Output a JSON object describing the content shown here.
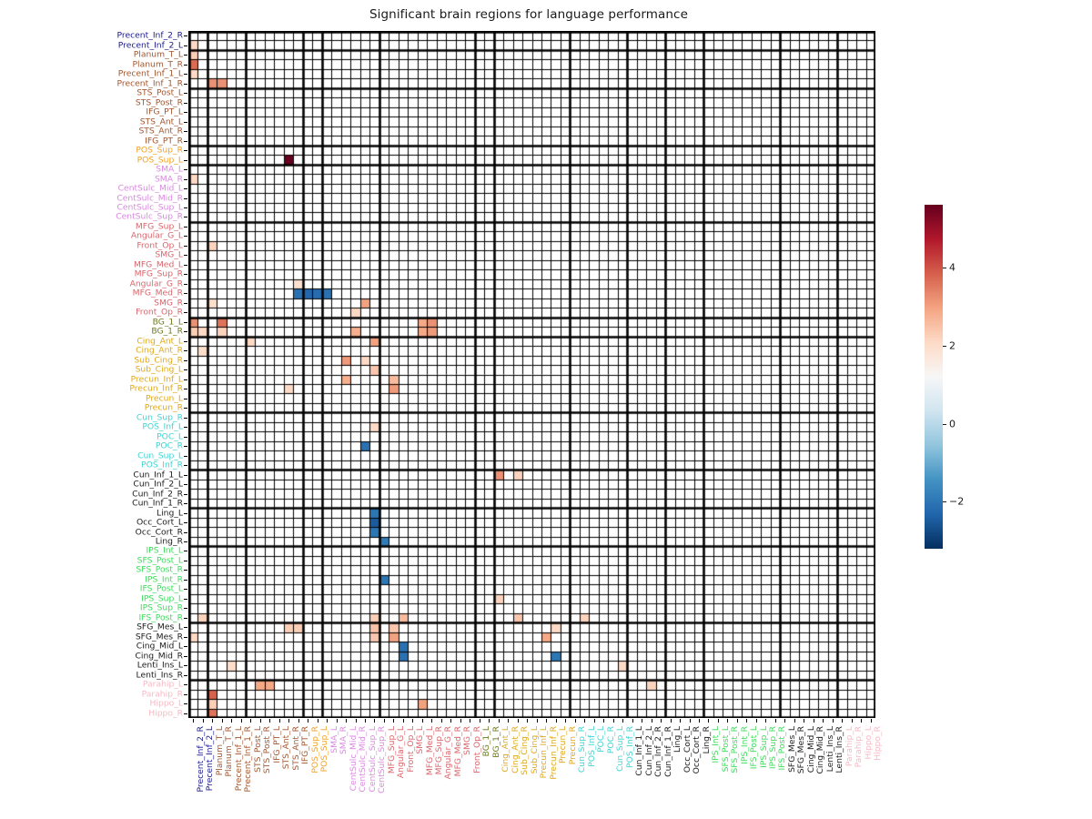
{
  "title": "Significant brain regions for language performance",
  "chart_data": {
    "type": "heatmap",
    "title": "Significant brain regions for language performance",
    "xlabel": "",
    "ylabel": "",
    "colormap": "RdBu_r",
    "vmin": -3.2,
    "vmax": 5.6,
    "colorbar": {
      "ticks": [
        -2,
        0,
        2,
        4
      ],
      "tick_labels": [
        "−2",
        "0",
        "2",
        "4"
      ],
      "position": "right"
    },
    "grid": true,
    "cell_edge_color": "#000000",
    "block_separator_color": "#000000",
    "n_rows": 57,
    "n_cols": 57,
    "symmetric_labels": true,
    "label_colors": {
      "navy": "#1a1a8c",
      "brown": "#a3562e",
      "orange": "#f2a125",
      "violet": "#d98ae0",
      "rose": "#d9656b",
      "olive": "#6e7a1e",
      "gold": "#dfa81a",
      "cyan": "#3fd4d4",
      "black": "#1a1a1a",
      "green": "#3ddc5c",
      "pink": "#f8b8c4"
    },
    "labels": [
      {
        "name": "Precent_Inf_2_R",
        "color": "navy"
      },
      {
        "name": "Precent_Inf_2_L",
        "color": "navy"
      },
      {
        "name": "Planum_T_L",
        "color": "brown"
      },
      {
        "name": "Planum_T_R",
        "color": "brown"
      },
      {
        "name": "Precent_Inf_1_L",
        "color": "brown"
      },
      {
        "name": "Precent_Inf_1_R",
        "color": "brown"
      },
      {
        "name": "STS_Post_L",
        "color": "brown"
      },
      {
        "name": "STS_Post_R",
        "color": "brown"
      },
      {
        "name": "IFG_PT_L",
        "color": "brown"
      },
      {
        "name": "STS_Ant_L",
        "color": "brown"
      },
      {
        "name": "STS_Ant_R",
        "color": "brown"
      },
      {
        "name": "IFG_PT_R",
        "color": "brown"
      },
      {
        "name": "POS_Sup_R",
        "color": "orange"
      },
      {
        "name": "POS_Sup_L",
        "color": "orange"
      },
      {
        "name": "SMA_L",
        "color": "violet"
      },
      {
        "name": "SMA_R",
        "color": "violet"
      },
      {
        "name": "CentSulc_Mid_L",
        "color": "violet"
      },
      {
        "name": "CentSulc_Mid_R",
        "color": "violet"
      },
      {
        "name": "CentSulc_Sup_L",
        "color": "violet"
      },
      {
        "name": "CentSulc_Sup_R",
        "color": "violet"
      },
      {
        "name": "MFG_Sup_L",
        "color": "rose"
      },
      {
        "name": "Angular_G_L",
        "color": "rose"
      },
      {
        "name": "Front_Op_L",
        "color": "rose"
      },
      {
        "name": "SMG_L",
        "color": "rose"
      },
      {
        "name": "MFG_Med_L",
        "color": "rose"
      },
      {
        "name": "MFG_Sup_R",
        "color": "rose"
      },
      {
        "name": "Angular_G_R",
        "color": "rose"
      },
      {
        "name": "MFG_Med_R",
        "color": "rose"
      },
      {
        "name": "SMG_R",
        "color": "rose"
      },
      {
        "name": "Front_Op_R",
        "color": "rose"
      },
      {
        "name": "BG_1_L",
        "color": "olive"
      },
      {
        "name": "BG_1_R",
        "color": "olive"
      },
      {
        "name": "Cing_Ant_L",
        "color": "gold"
      },
      {
        "name": "Cing_Ant_R",
        "color": "gold"
      },
      {
        "name": "Sub_Cing_R",
        "color": "gold"
      },
      {
        "name": "Sub_Cing_L",
        "color": "gold"
      },
      {
        "name": "Precun_Inf_L",
        "color": "gold"
      },
      {
        "name": "Precun_Inf_R",
        "color": "gold"
      },
      {
        "name": "Precun_L",
        "color": "gold"
      },
      {
        "name": "Precun_R",
        "color": "gold"
      },
      {
        "name": "Cun_Sup_R",
        "color": "cyan"
      },
      {
        "name": "POS_Inf_L",
        "color": "cyan"
      },
      {
        "name": "POC_L",
        "color": "cyan"
      },
      {
        "name": "POC_R",
        "color": "cyan"
      },
      {
        "name": "Cun_Sup_L",
        "color": "cyan"
      },
      {
        "name": "POS_Inf_R",
        "color": "cyan"
      },
      {
        "name": "Cun_Inf_1_L",
        "color": "black"
      },
      {
        "name": "Cun_Inf_2_L",
        "color": "black"
      },
      {
        "name": "Cun_Inf_2_R",
        "color": "black"
      },
      {
        "name": "Cun_Inf_1_R",
        "color": "black"
      },
      {
        "name": "Ling_L",
        "color": "black"
      },
      {
        "name": "Occ_Cort_L",
        "color": "black"
      },
      {
        "name": "Occ_Cort_R",
        "color": "black"
      },
      {
        "name": "Ling_R",
        "color": "black"
      },
      {
        "name": "IPS_Int_L",
        "color": "green"
      },
      {
        "name": "SFS_Post_L",
        "color": "green"
      },
      {
        "name": "SFS_Post_R",
        "color": "green"
      },
      {
        "name": "IPS_Int_R",
        "color": "green"
      },
      {
        "name": "IFS_Post_L",
        "color": "green"
      },
      {
        "name": "IPS_Sup_L",
        "color": "green"
      },
      {
        "name": "IPS_Sup_R",
        "color": "green"
      },
      {
        "name": "IFS_Post_R",
        "color": "green"
      },
      {
        "name": "SFG_Mes_L",
        "color": "black"
      },
      {
        "name": "SFG_Mes_R",
        "color": "black"
      },
      {
        "name": "Cing_Mid_L",
        "color": "black"
      },
      {
        "name": "Cing_Mid_R",
        "color": "black"
      },
      {
        "name": "Lenti_Ins_L",
        "color": "black"
      },
      {
        "name": "Lenti_Ins_R",
        "color": "black"
      },
      {
        "name": "Parahip_L",
        "color": "pink"
      },
      {
        "name": "Parahip_R",
        "color": "pink"
      },
      {
        "name": "Hippo_L",
        "color": "pink"
      },
      {
        "name": "Hippo_R",
        "color": "pink"
      }
    ],
    "block_boundaries": [
      2,
      6,
      12,
      14,
      20,
      30,
      32,
      40,
      46,
      50,
      54,
      62,
      68
    ],
    "cells": [
      {
        "row": 1,
        "col": 0,
        "value": 2.1
      },
      {
        "row": 2,
        "col": 0,
        "value": 2.3
      },
      {
        "row": 3,
        "col": 0,
        "value": 3.7
      },
      {
        "row": 4,
        "col": 0,
        "value": 2.1
      },
      {
        "row": 5,
        "col": 2,
        "value": 3.2
      },
      {
        "row": 5,
        "col": 3,
        "value": 3.2
      },
      {
        "row": 13,
        "col": 10,
        "value": 5.6
      },
      {
        "row": 15,
        "col": 0,
        "value": 2.1
      },
      {
        "row": 22,
        "col": 2,
        "value": 2.2
      },
      {
        "row": 26,
        "col": 11,
        "value": 1.9
      },
      {
        "row": 27,
        "col": 11,
        "value": -2.1
      },
      {
        "row": 27,
        "col": 12,
        "value": -2.3
      },
      {
        "row": 27,
        "col": 13,
        "value": -2.2
      },
      {
        "row": 27,
        "col": 14,
        "value": -2.1
      },
      {
        "row": 28,
        "col": 2,
        "value": 2.0
      },
      {
        "row": 28,
        "col": 18,
        "value": 3.0
      },
      {
        "row": 29,
        "col": 17,
        "value": 2.1
      },
      {
        "row": 30,
        "col": 0,
        "value": 3.2
      },
      {
        "row": 30,
        "col": 3,
        "value": 3.6
      },
      {
        "row": 30,
        "col": 24,
        "value": 2.9
      },
      {
        "row": 30,
        "col": 25,
        "value": 3.2
      },
      {
        "row": 31,
        "col": 0,
        "value": 2.3
      },
      {
        "row": 31,
        "col": 1,
        "value": 2.1
      },
      {
        "row": 31,
        "col": 3,
        "value": 2.2
      },
      {
        "row": 31,
        "col": 17,
        "value": 2.8
      },
      {
        "row": 31,
        "col": 24,
        "value": 2.9
      },
      {
        "row": 31,
        "col": 25,
        "value": 3.1
      },
      {
        "row": 32,
        "col": 6,
        "value": 2.1
      },
      {
        "row": 32,
        "col": 19,
        "value": 3.0
      },
      {
        "row": 33,
        "col": 1,
        "value": 2.0
      },
      {
        "row": 34,
        "col": 16,
        "value": 3.1
      },
      {
        "row": 34,
        "col": 18,
        "value": 2.1
      },
      {
        "row": 35,
        "col": 19,
        "value": 2.4
      },
      {
        "row": 36,
        "col": 16,
        "value": 2.8
      },
      {
        "row": 36,
        "col": 21,
        "value": 2.6
      },
      {
        "row": 37,
        "col": 10,
        "value": 2.1
      },
      {
        "row": 37,
        "col": 21,
        "value": 3.1
      },
      {
        "row": 41,
        "col": 19,
        "value": 2.1
      },
      {
        "row": 43,
        "col": 18,
        "value": -2.1
      },
      {
        "row": 46,
        "col": 32,
        "value": 3.2
      },
      {
        "row": 46,
        "col": 34,
        "value": 2.2
      },
      {
        "row": 50,
        "col": 19,
        "value": -2.0
      },
      {
        "row": 51,
        "col": 19,
        "value": -2.5
      },
      {
        "row": 52,
        "col": 19,
        "value": -2.0
      },
      {
        "row": 53,
        "col": 20,
        "value": -1.9
      },
      {
        "row": 57,
        "col": 20,
        "value": -2.0
      },
      {
        "row": 59,
        "col": 32,
        "value": 2.2
      },
      {
        "row": 61,
        "col": 34,
        "value": 2.4
      },
      {
        "row": 61,
        "col": 41,
        "value": 2.2
      },
      {
        "row": 61,
        "col": 1,
        "value": 2.2
      },
      {
        "row": 61,
        "col": 19,
        "value": 2.3
      },
      {
        "row": 61,
        "col": 22,
        "value": 2.6
      },
      {
        "row": 62,
        "col": 10,
        "value": 2.3
      },
      {
        "row": 62,
        "col": 11,
        "value": 2.3
      },
      {
        "row": 62,
        "col": 19,
        "value": 2.5
      },
      {
        "row": 62,
        "col": 21,
        "value": 2.4
      },
      {
        "row": 62,
        "col": 38,
        "value": 2.1
      },
      {
        "row": 63,
        "col": 0,
        "value": 2.1
      },
      {
        "row": 63,
        "col": 19,
        "value": 2.4
      },
      {
        "row": 63,
        "col": 21,
        "value": 3.0
      },
      {
        "row": 63,
        "col": 37,
        "value": 2.9
      },
      {
        "row": 64,
        "col": 22,
        "value": -2.1
      },
      {
        "row": 65,
        "col": 22,
        "value": -2.1
      },
      {
        "row": 65,
        "col": 38,
        "value": -2.0
      },
      {
        "row": 66,
        "col": 4,
        "value": 2.0
      },
      {
        "row": 66,
        "col": 45,
        "value": 2.1
      },
      {
        "row": 68,
        "col": 7,
        "value": 2.9
      },
      {
        "row": 68,
        "col": 8,
        "value": 2.9
      },
      {
        "row": 68,
        "col": 48,
        "value": 2.2
      },
      {
        "row": 69,
        "col": 2,
        "value": 3.8
      },
      {
        "row": 70,
        "col": 2,
        "value": 2.3
      },
      {
        "row": 70,
        "col": 24,
        "value": 3.0
      },
      {
        "row": 71,
        "col": 2,
        "value": 3.6
      }
    ]
  }
}
